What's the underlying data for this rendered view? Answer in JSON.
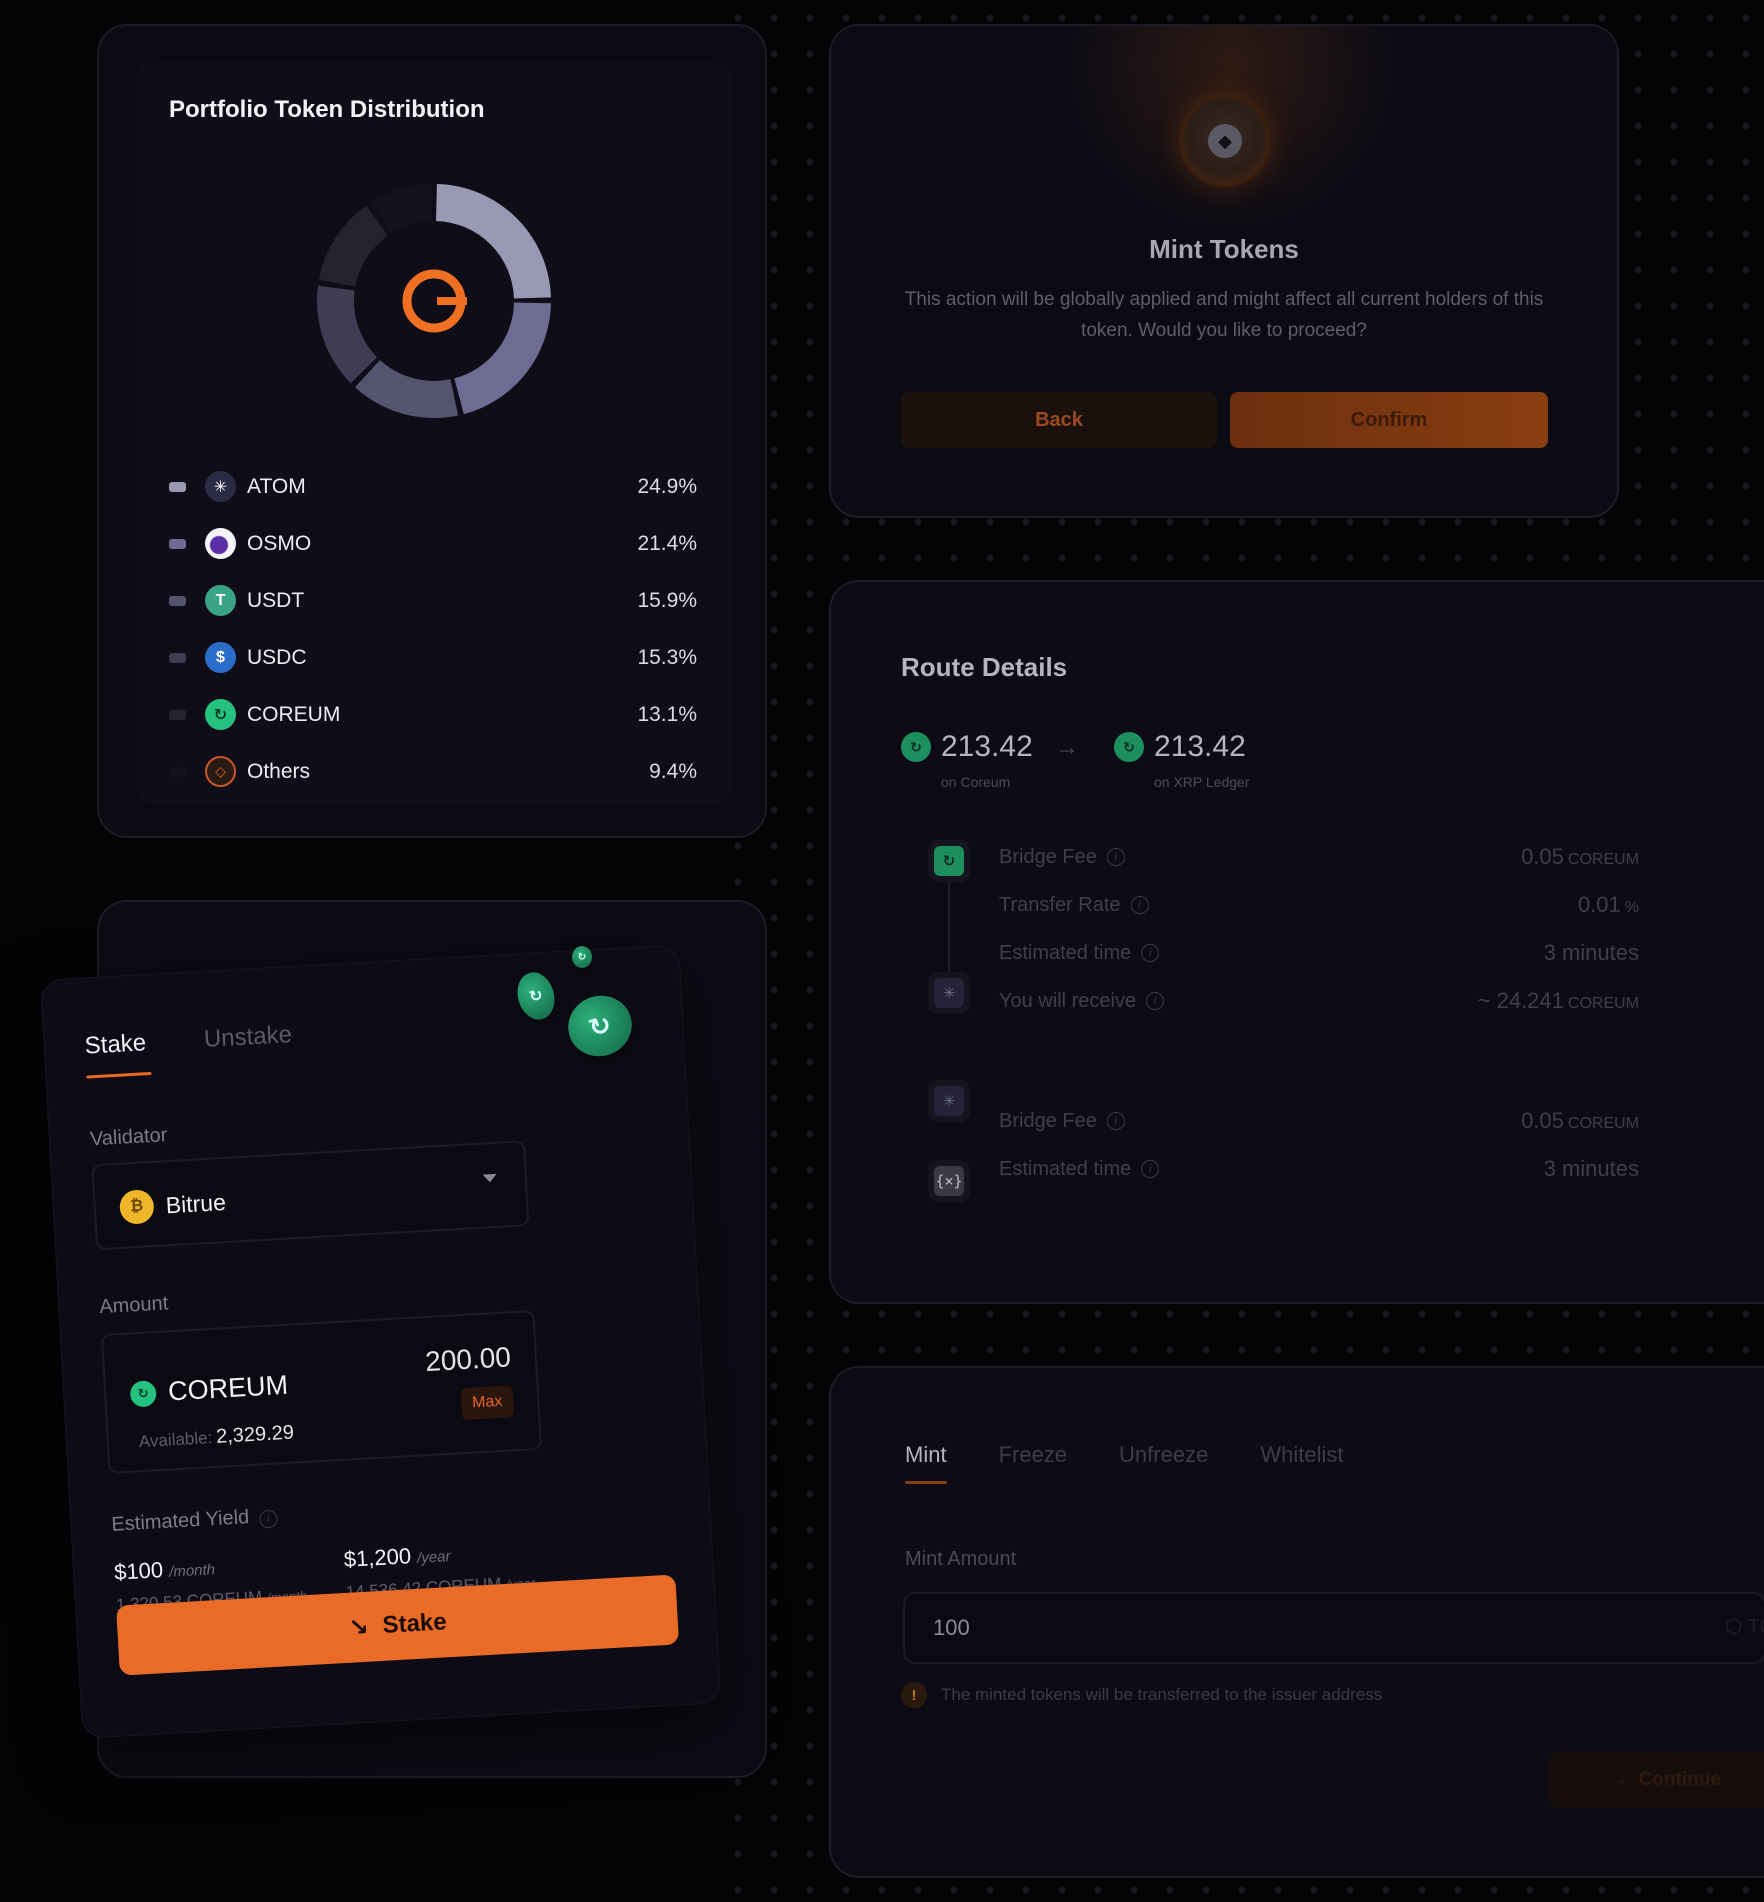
{
  "portfolio": {
    "title": "Portfolio Token Distribution",
    "center_icon": "coreum-logo-icon",
    "tokens": [
      {
        "name": "ATOM",
        "pct": "24.9%",
        "value": 24.9,
        "color": "#9a99b5",
        "icon": "atom-icon"
      },
      {
        "name": "OSMO",
        "pct": "21.4%",
        "value": 21.4,
        "color": "#6e6c92",
        "icon": "osmo-icon"
      },
      {
        "name": "USDT",
        "pct": "15.9%",
        "value": 15.9,
        "color": "#55546f",
        "icon": "usdt-icon"
      },
      {
        "name": "USDC",
        "pct": "15.3%",
        "value": 15.3,
        "color": "#3e3d52",
        "icon": "usdc-icon"
      },
      {
        "name": "COREUM",
        "pct": "13.1%",
        "value": 13.1,
        "color": "#24232f",
        "icon": "coreum-icon"
      },
      {
        "name": "Others",
        "pct": "9.4%",
        "value": 9.4,
        "color": "#14131c",
        "icon": "others-icon"
      }
    ]
  },
  "mint_dialog": {
    "title": "Mint Tokens",
    "message": "This action will be globally applied and might affect all current holders of this token. Would you like to proceed?",
    "back_label": "Back",
    "confirm_label": "Confirm"
  },
  "route": {
    "title": "Route Details",
    "from_amount": "213.42",
    "from_chain": "on Coreum",
    "to_amount": "213.42",
    "to_chain": "on XRP Ledger",
    "rows_top": [
      {
        "label": "Bridge Fee",
        "value": "0.05",
        "unit": "COREUM"
      },
      {
        "label": "Transfer Rate",
        "value": "0.01",
        "unit": "%"
      },
      {
        "label": "Estimated time",
        "value": "3 minutes",
        "unit": ""
      },
      {
        "label": "You will receive",
        "value": "~ 24.241",
        "unit": "COREUM"
      }
    ],
    "rows_bottom": [
      {
        "label": "Bridge Fee",
        "value": "0.05",
        "unit": "COREUM"
      },
      {
        "label": "Estimated time",
        "value": "3 minutes",
        "unit": ""
      }
    ]
  },
  "mint_form": {
    "tabs": [
      "Mint",
      "Freeze",
      "Unfreeze",
      "Whitelist"
    ],
    "amount_label": "Mint Amount",
    "amount_value": "100",
    "token_suffix": "TOK",
    "warning": "The minted tokens will be transferred to the issuer address",
    "continue_label": "Continue"
  },
  "stake": {
    "tabs": [
      "Stake",
      "Unstake"
    ],
    "validator_label": "Validator",
    "validator_name": "Bitrue",
    "amount_label": "Amount",
    "token": "COREUM",
    "amount": "200.00",
    "max_label": "Max",
    "available_label": "Available:",
    "available_value": "2,329.29",
    "yield_label": "Estimated Yield",
    "monthly_usd": "$100",
    "monthly_unit": "/month",
    "monthly_coreum": "1,320.53 COREUM",
    "monthly_coreum_unit": "/month",
    "yearly_usd": "$1,200",
    "yearly_unit": "/year",
    "yearly_coreum": "14,536.42 COREUM",
    "yearly_coreum_unit": "/year",
    "button_label": "Stake"
  }
}
